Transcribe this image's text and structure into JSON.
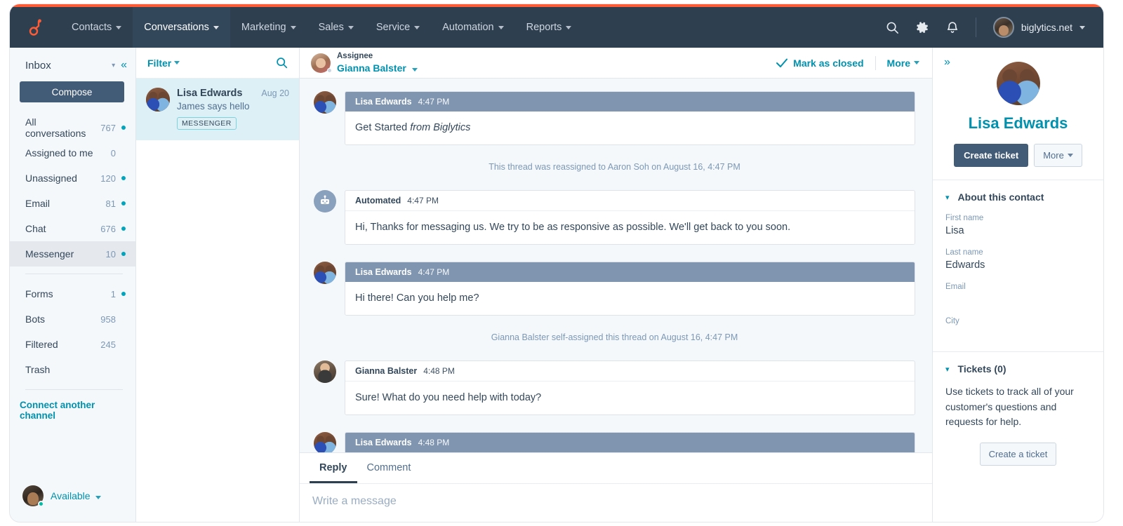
{
  "brand": {
    "accent_orange": "#ff5c35",
    "teal": "#0091ae",
    "navy": "#2e3f50",
    "slate": "#7f95b0"
  },
  "topnav": {
    "logo": "hubspot-sprocket-logo",
    "items": [
      {
        "label": "Contacts",
        "active": false
      },
      {
        "label": "Conversations",
        "active": true
      },
      {
        "label": "Marketing",
        "active": false
      },
      {
        "label": "Sales",
        "active": false
      },
      {
        "label": "Service",
        "active": false
      },
      {
        "label": "Automation",
        "active": false
      },
      {
        "label": "Reports",
        "active": false
      }
    ],
    "icons": [
      "search-icon",
      "gear-icon",
      "bell-icon"
    ],
    "account": "biglytics.net"
  },
  "sidebar": {
    "title": "Inbox",
    "compose_label": "Compose",
    "folders": [
      {
        "name": "All conversations",
        "count": "767",
        "dot": true,
        "active": false
      },
      {
        "name": "Assigned to me",
        "count": "0",
        "dot": false,
        "active": false
      },
      {
        "name": "Unassigned",
        "count": "120",
        "dot": true,
        "active": false
      },
      {
        "name": "Email",
        "count": "81",
        "dot": true,
        "active": false
      },
      {
        "name": "Chat",
        "count": "676",
        "dot": true,
        "active": false
      },
      {
        "name": "Messenger",
        "count": "10",
        "dot": true,
        "active": true
      }
    ],
    "folders2": [
      {
        "name": "Forms",
        "count": "1",
        "dot": true,
        "active": false
      },
      {
        "name": "Bots",
        "count": "958",
        "dot": false,
        "active": false
      },
      {
        "name": "Filtered",
        "count": "245",
        "dot": false,
        "active": false
      },
      {
        "name": "Trash",
        "count": "",
        "dot": false,
        "active": false
      }
    ],
    "connect_label": "Connect another channel",
    "status_label": "Available"
  },
  "convlist": {
    "filter_label": "Filter",
    "search_icon": "search-icon",
    "items": [
      {
        "name": "Lisa Edwards",
        "preview": "James says hello",
        "date": "Aug 20",
        "badge": "MESSENGER",
        "selected": true
      }
    ]
  },
  "thread": {
    "assignee_label": "Assignee",
    "assignee_name": "Gianna Balster",
    "mark_closed_label": "Mark as closed",
    "more_label": "More",
    "messages": [
      {
        "kind": "message",
        "author": "Lisa Edwards",
        "time": "4:47 PM",
        "avatar": "lisa-avatar",
        "customer": true,
        "text": "Get Started ",
        "text_em": "from Biglytics"
      },
      {
        "kind": "system",
        "text": "This thread was reassigned to Aaron Soh on August 16, 4:47 PM"
      },
      {
        "kind": "message",
        "author": "Automated",
        "time": "4:47 PM",
        "avatar": "bot-avatar",
        "customer": false,
        "text": "Hi,  Thanks for messaging us. We try to be as responsive as possible. We'll get back to you soon.",
        "text_em": ""
      },
      {
        "kind": "message",
        "author": "Lisa Edwards",
        "time": "4:47 PM",
        "avatar": "lisa-avatar",
        "customer": true,
        "text": "Hi there! Can you help me?",
        "text_em": ""
      },
      {
        "kind": "system",
        "text": "Gianna Balster self-assigned this thread on August 16, 4:47 PM"
      },
      {
        "kind": "message",
        "author": "Gianna Balster",
        "time": "4:48 PM",
        "avatar": "gianna-avatar",
        "customer": false,
        "text": "Sure! What do you need help with today?",
        "text_em": ""
      },
      {
        "kind": "message-clipped",
        "author": "Lisa Edwards",
        "time": "4:48 PM",
        "avatar": "lisa-avatar",
        "customer": true,
        "text": "",
        "text_em": ""
      }
    ]
  },
  "composer": {
    "tabs": [
      {
        "label": "Reply",
        "active": true
      },
      {
        "label": "Comment",
        "active": false
      }
    ],
    "placeholder": "Write a message"
  },
  "rpanel": {
    "expand_icon": "chevrons-right-icon",
    "contact_name": "Lisa Edwards",
    "create_ticket_label": "Create ticket",
    "more_label": "More",
    "about": {
      "title": "About this contact",
      "properties": [
        {
          "label": "First name",
          "value": "Lisa"
        },
        {
          "label": "Last name",
          "value": "Edwards"
        },
        {
          "label": "Email",
          "value": ""
        },
        {
          "label": "City",
          "value": ""
        }
      ]
    },
    "tickets": {
      "title": "Tickets (0)",
      "description": "Use tickets to track all of your customer's questions and requests for help.",
      "button_label": "Create a ticket"
    }
  }
}
